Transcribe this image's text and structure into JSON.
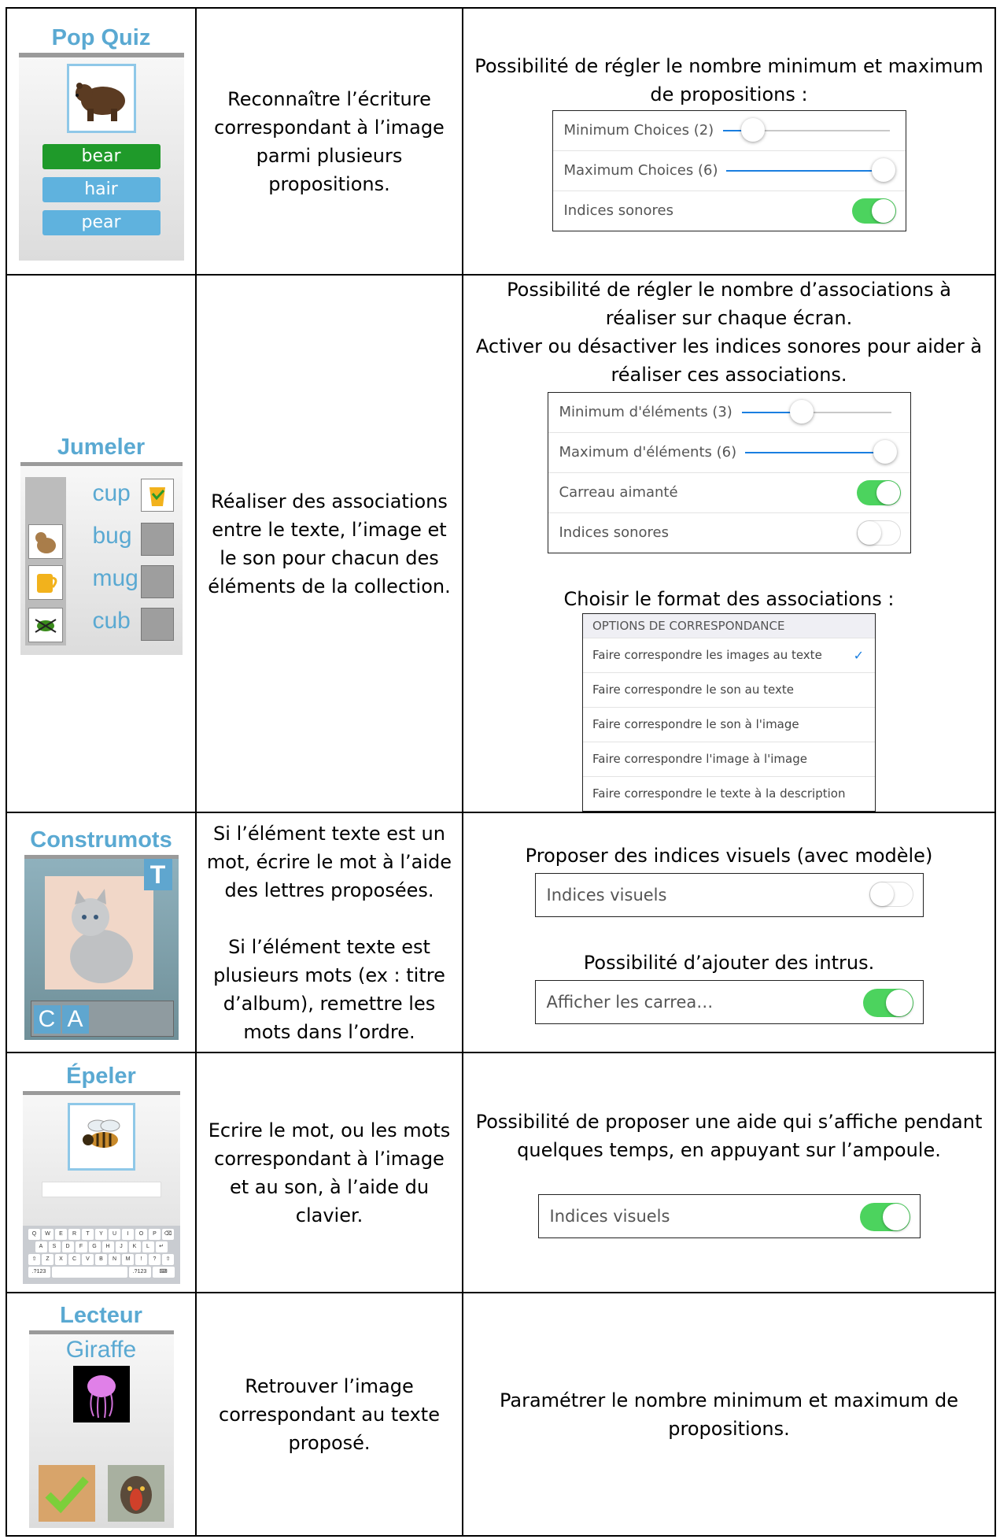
{
  "rows": [
    {
      "app": {
        "title": "Pop Quiz",
        "image": "bear-icon",
        "answers": [
          "bear",
          "hair",
          "pear"
        ]
      },
      "description": [
        "Reconnaître l’écriture",
        "correspondant à l’image",
        "parmi plusieurs",
        "propositions."
      ],
      "options": {
        "heading": [
          "Possibilité de régler le nombre minimum et maximum",
          "de propositions :"
        ],
        "settings": [
          {
            "label": "Minimum Choices (2)",
            "type": "slider",
            "level": 0.18
          },
          {
            "label": "Maximum Choices (6)",
            "type": "slider",
            "level": 1.0
          },
          {
            "label": "Indices sonores",
            "type": "toggle",
            "on": true
          }
        ]
      }
    },
    {
      "app": {
        "title": "Jumeler",
        "words": [
          "cup",
          "bug",
          "mug",
          "cub"
        ],
        "images": [
          "bear-cub-icon",
          "mug-icon",
          "bug-icon"
        ]
      },
      "description": [
        "Réaliser des associations",
        "entre le texte, l’image et",
        "le son pour chacun des",
        "éléments de la collection."
      ],
      "options": {
        "heading": [
          "Possibilité de régler le nombre d’associations à",
          "réaliser sur chaque écran.",
          "Activer ou désactiver les indices sonores pour aider à",
          "réaliser ces associations."
        ],
        "settings": [
          {
            "label": "Minimum d'éléments (3)",
            "type": "slider",
            "level": 0.4
          },
          {
            "label": "Maximum d'éléments (6)",
            "type": "slider",
            "level": 1.0
          },
          {
            "label": "Carreau aimanté",
            "type": "toggle",
            "on": true
          },
          {
            "label": "Indices sonores",
            "type": "toggle",
            "on": false
          }
        ],
        "format_heading": "Choisir le format des associations :",
        "match_header": "OPTIONS DE CORRESPONDANCE",
        "match_options": [
          {
            "label": "Faire correspondre les images au texte",
            "checked": true
          },
          {
            "label": "Faire correspondre le son au texte",
            "checked": false
          },
          {
            "label": "Faire correspondre le son à l'image",
            "checked": false
          },
          {
            "label": "Faire correspondre l'image à l'image",
            "checked": false
          },
          {
            "label": "Faire correspondre le texte à la description",
            "checked": false
          }
        ],
        "check_mark": "✓"
      }
    },
    {
      "app": {
        "title": "Construmots",
        "badge": "T",
        "letters": [
          "C",
          "A"
        ],
        "image": "cat-icon"
      },
      "description_a": [
        "Si l’élément texte est un",
        "mot, écrire le mot à l’aide",
        "des lettres proposées."
      ],
      "description_b": [
        "Si l’élément texte est",
        "plusieurs mots (ex : titre",
        "d’album), remettre les",
        "mots dans l’ordre."
      ],
      "options": {
        "heading_a": "Proposer des indices visuels (avec modèle)",
        "setting_a": {
          "label": "Indices visuels",
          "type": "toggle",
          "on": false
        },
        "heading_b": "Possibilité d’ajouter des intrus.",
        "setting_b": {
          "label": "Afficher les carrea…",
          "type": "toggle",
          "on": true
        }
      }
    },
    {
      "app": {
        "title": "Épeler",
        "image": "bee-icon",
        "keyboard_rows": [
          [
            "Q",
            "W",
            "E",
            "R",
            "T",
            "Y",
            "U",
            "I",
            "O",
            "P",
            "⌫"
          ],
          [
            "A",
            "S",
            "D",
            "F",
            "G",
            "H",
            "J",
            "K",
            "L",
            "↵"
          ],
          [
            "⇧",
            "Z",
            "X",
            "C",
            "V",
            "B",
            "N",
            "M",
            "!",
            "?",
            "⇧"
          ],
          [
            ".?123",
            "",
            ".?123",
            "⌨"
          ]
        ]
      },
      "description": [
        "Ecrire le mot, ou les mots",
        "correspondant à l’image",
        "et au son, à l’aide du",
        "clavier."
      ],
      "options": {
        "heading": [
          "Possibilité de proposer une aide qui s’affiche pendant",
          "quelques temps, en appuyant sur l’ampoule."
        ],
        "setting": {
          "label": "Indices visuels",
          "type": "toggle",
          "on": true
        }
      }
    },
    {
      "app": {
        "title": "Lecteur",
        "word": "Giraffe",
        "images": [
          "jellyfish-icon",
          "checkmark-icon",
          "mandrill-icon"
        ]
      },
      "description": [
        "Retrouver l’image",
        "correspondant au texte",
        "proposé."
      ],
      "options": {
        "heading": [
          "Paramétrer le nombre minimum et maximum de",
          "propositions."
        ]
      }
    }
  ],
  "colors": {
    "app_title": "#5aa9d2",
    "answer_correct": "#1f9a2a",
    "answer_other": "#5fb2de",
    "toggle_on": "#4cd35e",
    "slider_active": "#1a7ee0"
  }
}
